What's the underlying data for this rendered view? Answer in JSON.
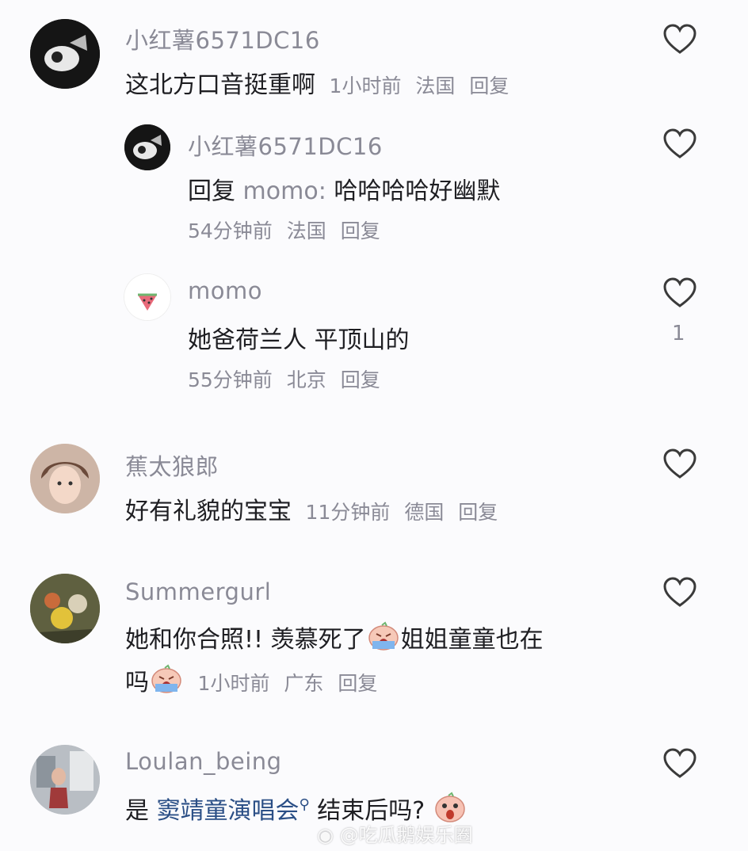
{
  "comments": [
    {
      "username": "小红薯6571DC16",
      "text": "这北方口音挺重啊",
      "time": "1小时前",
      "location": "法国",
      "reply_label": "回复"
    },
    {
      "username": "小红薯6571DC16",
      "reply_prefix": "回复",
      "reply_to": "momo:",
      "text": "哈哈哈哈好幽默",
      "time": "54分钟前",
      "location": "法国",
      "reply_label": "回复"
    },
    {
      "username": "momo",
      "text": "她爸荷兰人 平顶山的",
      "time": "55分钟前",
      "location": "北京",
      "reply_label": "回复",
      "likes": "1"
    },
    {
      "username": "蕉太狼郎",
      "text": "好有礼貌的宝宝",
      "time": "11分钟前",
      "location": "德国",
      "reply_label": "回复"
    },
    {
      "username": "Summergurl",
      "text_part1": "她和你合照!! 羡慕死了",
      "text_part2": "姐姐童童也在",
      "text_part3": "吗",
      "time": "1小时前",
      "location": "广东",
      "reply_label": "回复"
    },
    {
      "username": "Loulan_being",
      "text_prefix": "是 ",
      "text_link": "窦靖童演唱会",
      "text_suffix": " 结束后吗?"
    }
  ],
  "icons": {
    "like": "heart-outline-icon",
    "crying": "crying-emoji-icon",
    "shocked": "shocked-emoji-icon",
    "search": "search-icon",
    "weibo": "weibo-logo-icon"
  },
  "watermark": "@吃瓜鹅娱乐圈",
  "colors": {
    "muted": "#8a8a96",
    "text": "#1e1e22",
    "link": "#2b4f86",
    "background": "#fbfbfd"
  }
}
